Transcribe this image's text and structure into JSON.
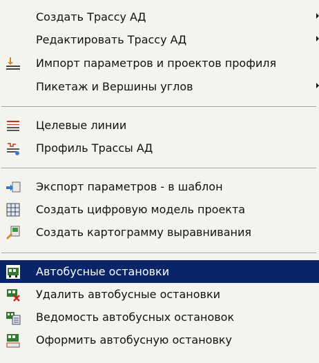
{
  "menu": {
    "group1": [
      {
        "label": "Создать Трассу АД",
        "icon": "none",
        "submenu": true
      },
      {
        "label": "Редактировать Трассу АД",
        "icon": "none",
        "submenu": true
      },
      {
        "label": "Импорт параметров и проектов профиля",
        "icon": "import-profile-icon",
        "submenu": false
      },
      {
        "label": "Пикетаж и Вершины углов",
        "icon": "none",
        "submenu": true
      }
    ],
    "group2": [
      {
        "label": "Целевые линии",
        "icon": "target-lines-icon"
      },
      {
        "label": "Профиль Трассы АД",
        "icon": "road-profile-icon"
      }
    ],
    "group3": [
      {
        "label": "Экспорт параметров - в шаблон",
        "icon": "export-template-icon"
      },
      {
        "label": "Создать цифровую модель проекта",
        "icon": "digital-model-icon"
      },
      {
        "label": "Создать картограмму выравнивания",
        "icon": "cartogram-icon"
      }
    ],
    "group4": [
      {
        "label": "Автобусные остановки",
        "icon": "bus-stop-icon",
        "selected": true
      },
      {
        "label": "Удалить автобусные остановки",
        "icon": "delete-bus-stop-icon"
      },
      {
        "label": "Ведомость автобусных остановок",
        "icon": "bus-stop-list-icon"
      },
      {
        "label": "Оформить автобусную остановку",
        "icon": "format-bus-stop-icon"
      }
    ]
  },
  "colors": {
    "menu_bg": "#f4f3ee",
    "selected_bg": "#0a246a",
    "selected_text": "#ffffff",
    "text": "#111111"
  }
}
